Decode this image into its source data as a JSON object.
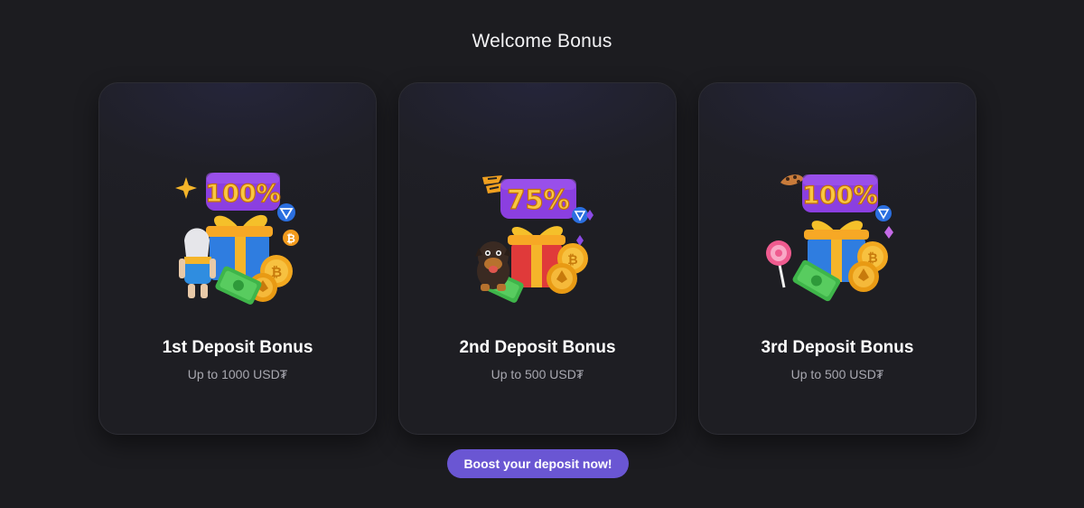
{
  "page": {
    "title": "Welcome Bonus"
  },
  "cards": [
    {
      "percent": "100%",
      "title": "1st Deposit Bonus",
      "subtitle": "Up to 1000 USD₮",
      "mascot": "zeus-character-icon",
      "accent": "#8b3fe0"
    },
    {
      "percent": "75%",
      "title": "2nd Deposit Bonus",
      "subtitle": "Up to 500 USD₮",
      "mascot": "dog-character-icon",
      "accent": "#8b3fe0"
    },
    {
      "percent": "100%",
      "title": "3rd Deposit Bonus",
      "subtitle": "Up to 500 USD₮",
      "mascot": "lollipop-icon",
      "accent": "#8b3fe0"
    }
  ],
  "cta": {
    "label": "Boost your deposit now!",
    "color": "#6a56d3"
  },
  "colors": {
    "background": "#1c1c20",
    "card": "#1f1f26",
    "gold": "#f5b52a",
    "purple_badge": "#8b3fe0",
    "gift_blue": "#2f7de0",
    "gift_red": "#e03a3a",
    "money_green": "#3fb54a"
  }
}
